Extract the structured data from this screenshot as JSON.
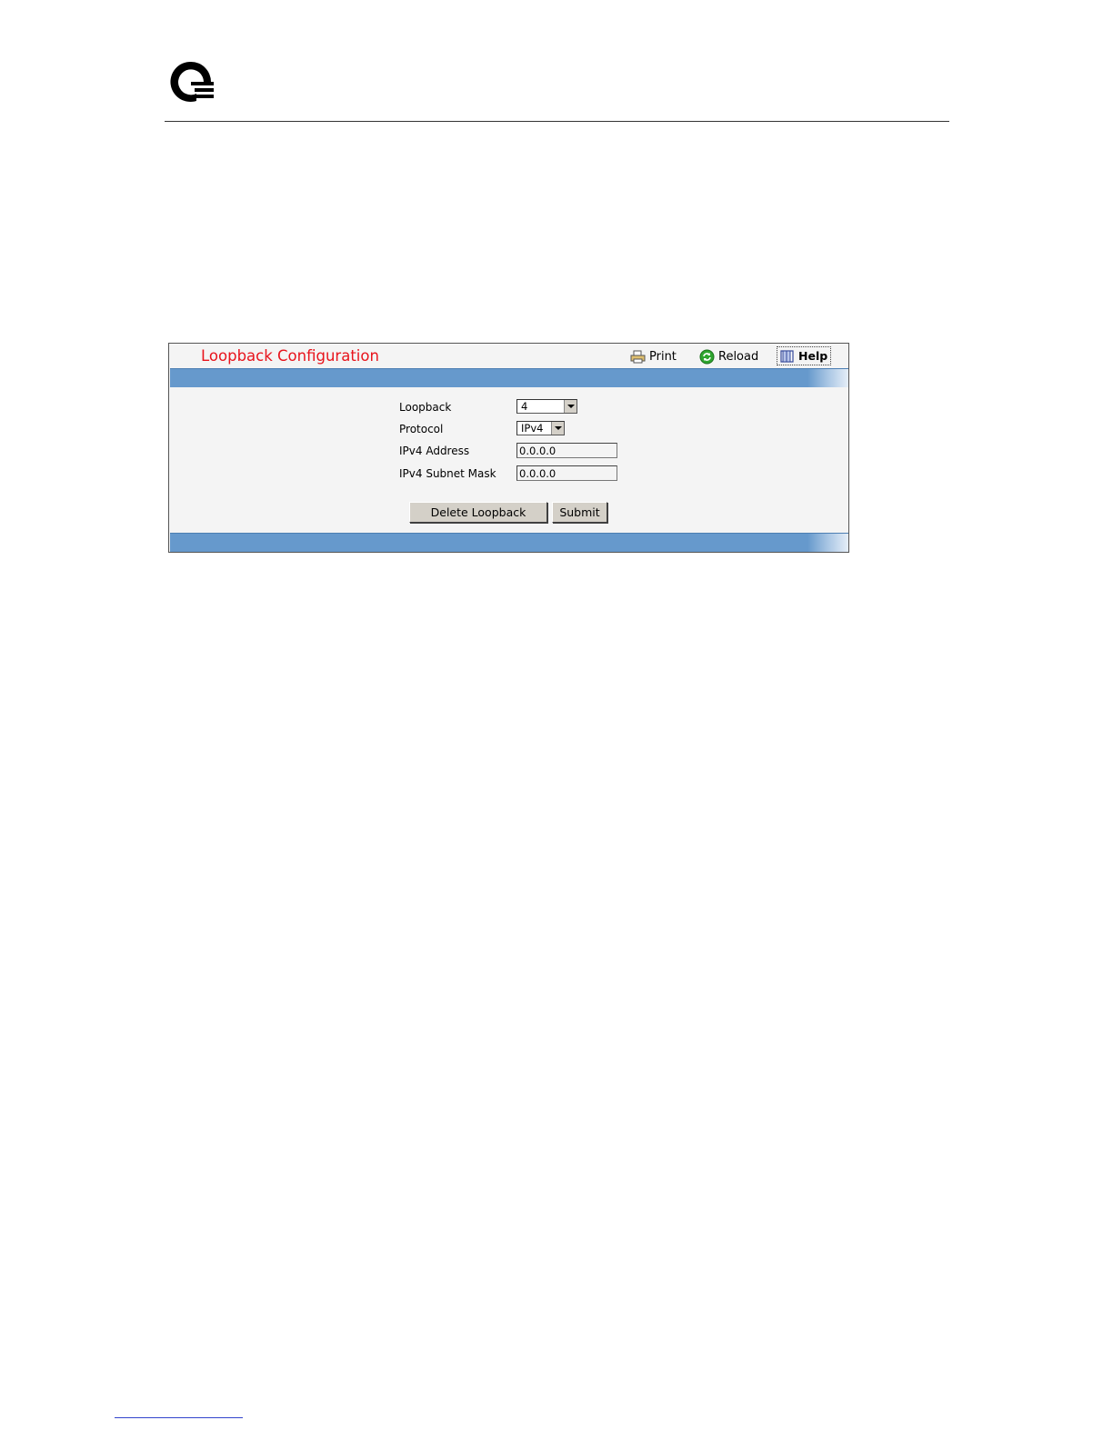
{
  "panel": {
    "title": "Loopback Configuration",
    "toolbar": {
      "print_label": "Print",
      "reload_label": "Reload",
      "help_label": "Help"
    }
  },
  "form": {
    "loopback": {
      "label": "Loopback",
      "selected": "4"
    },
    "protocol": {
      "label": "Protocol",
      "selected": "IPv4"
    },
    "ipv4_address": {
      "label": "IPv4 Address",
      "value": "0.0.0.0"
    },
    "ipv4_subnet_mask": {
      "label": "IPv4 Subnet Mask",
      "value": "0.0.0.0"
    }
  },
  "buttons": {
    "delete_label": "Delete Loopback",
    "submit_label": "Submit"
  },
  "colors": {
    "title": "#e8141c",
    "bar": "#6699cc",
    "panel_bg": "#f4f4f4",
    "button_bg": "#d4d0c8"
  }
}
